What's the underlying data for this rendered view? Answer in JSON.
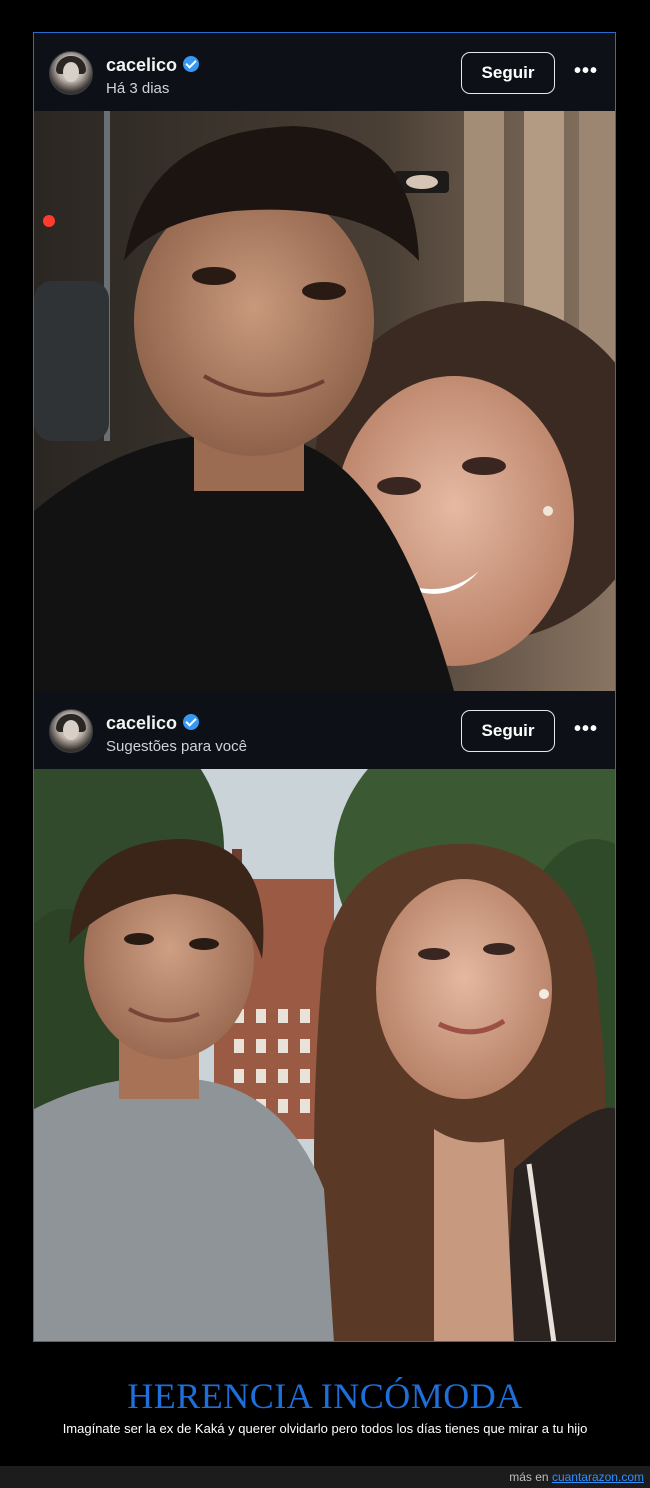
{
  "posts": [
    {
      "username": "cacelico",
      "subtitle": "Há 3 dias",
      "follow_label": "Seguir",
      "more_label": "•••",
      "photo_description_icon": "photo-selfie-night-street"
    },
    {
      "username": "cacelico",
      "subtitle": "Sugestões para você",
      "follow_label": "Seguir",
      "more_label": "•••",
      "photo_description_icon": "photo-selfie-park-day"
    }
  ],
  "meme": {
    "title": "HERENCIA INCÓMODA",
    "description": "Imagínate ser la ex de Kaká y querer olvidarlo pero todos los días tienes que mirar a tu hijo"
  },
  "footer": {
    "prefix": "más en",
    "link": "cuantarazon.com"
  },
  "colors": {
    "frame_border": "#2b6bd1",
    "title": "#1e6fd9",
    "link": "#2e8fff",
    "verified": "#3897f0"
  }
}
